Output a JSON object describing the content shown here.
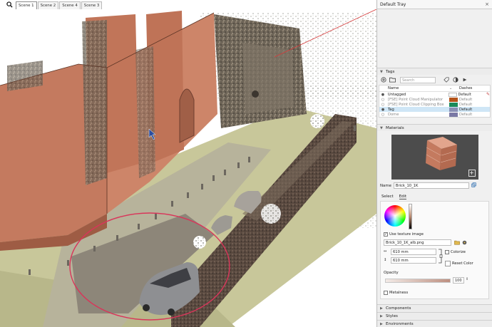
{
  "scene_tabs": [
    "Scene 1",
    "Scene 2",
    "Scene 4",
    "Scene 3"
  ],
  "tray": {
    "title": "Default Tray",
    "close_glyph": "×",
    "tags": {
      "section_label": "Tags",
      "search_placeholder": "Search",
      "headers": {
        "name": "Name",
        "dashes": "Dashes"
      },
      "rows": [
        {
          "name": "Untagged",
          "color": "#ffffff",
          "dashes": "Default",
          "visible": true
        },
        {
          "name": "[FSE] Point Cloud Manipulator",
          "color": "#b4531a",
          "dashes": "Default",
          "visible": false
        },
        {
          "name": "[FSE] Point Cloud Clipping Box",
          "color": "#1a8a5a",
          "dashes": "Default",
          "visible": false
        },
        {
          "name": "Tag",
          "color": "#8a8fb5",
          "dashes": "Default",
          "visible": true,
          "selected": true
        },
        {
          "name": "Dome",
          "color": "#7a78a5",
          "dashes": "Default",
          "visible": false
        }
      ]
    },
    "materials": {
      "section_label": "Materials",
      "name_label": "Name",
      "name_value": "Brick_10_1K",
      "add_glyph": "+",
      "tabs": [
        "Select",
        "Edit"
      ],
      "use_texture_label": "Use texture image",
      "use_texture_checked": "✓",
      "texture_file": "Brick_10_1K_alb.png",
      "width_value": "610 mm",
      "height_value": "610 mm",
      "colorize_label": "Colorize",
      "reset_color_label": "Reset Color",
      "opacity_label": "Opacity",
      "opacity_value": "100",
      "metalness_label": "Metalness"
    },
    "collapsed_sections": [
      "Components",
      "Styles",
      "Environments"
    ]
  },
  "colors": {
    "brick": "#c47a5f",
    "ground": "#c8c79a",
    "selection_circle": "#d9355a",
    "axis_red": "#d83a3a",
    "tag_selected": "#cfe6f6"
  }
}
